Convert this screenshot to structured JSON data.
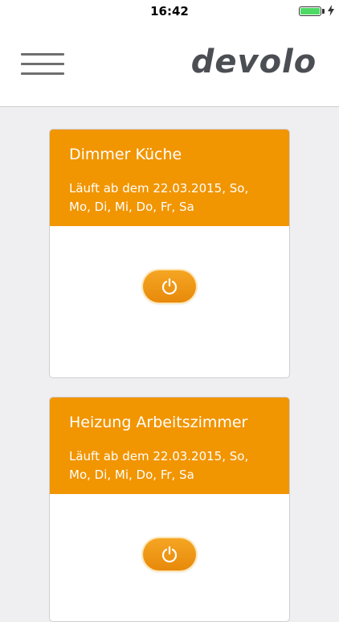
{
  "status_bar": {
    "time": "16:42",
    "battery_color": "#4cd964"
  },
  "header": {
    "logo_text": "devolo",
    "menu_icon": "hamburger-menu-icon"
  },
  "colors": {
    "accent": "#f19500",
    "background": "#efeff1"
  },
  "cards": [
    {
      "title": "Dimmer Küche",
      "schedule": "Läuft ab dem 22.03.2015, So, Mo, Di, Mi, Do, Fr, Sa",
      "toggle_icon": "power-icon"
    },
    {
      "title": "Heizung Arbeitszimmer",
      "schedule": "Läuft ab dem 22.03.2015, So, Mo, Di, Mi, Do, Fr, Sa",
      "toggle_icon": "power-icon"
    }
  ]
}
